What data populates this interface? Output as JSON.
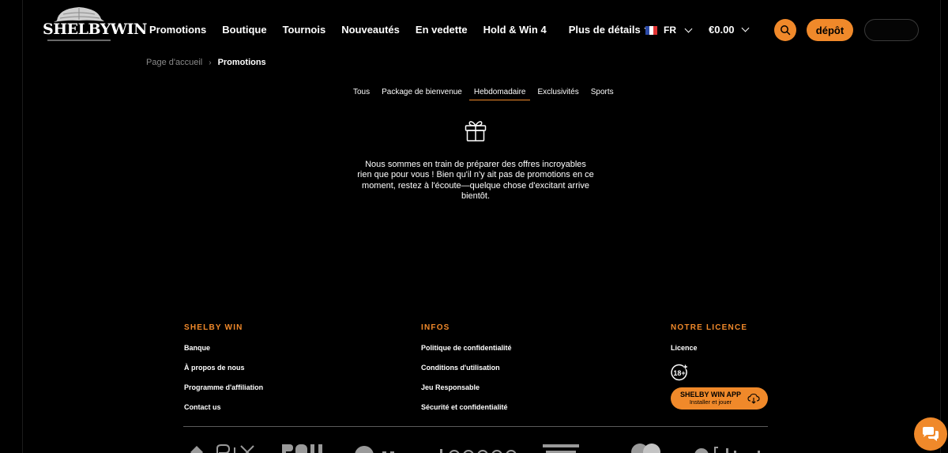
{
  "brand": {
    "logo_text": "SHELBYWIN"
  },
  "nav": {
    "items": [
      "Promotions",
      "Boutique",
      "Tournois",
      "Nouveautés",
      "En vedette",
      "Hold & Win 4"
    ],
    "more_label": "Plus de détails"
  },
  "language": {
    "code": "FR",
    "flag_colors": [
      "#2b4aa8",
      "#ffffff",
      "#e03434"
    ]
  },
  "wallet": {
    "balance": "€0.00"
  },
  "actions": {
    "deposit_label": "dépôt"
  },
  "breadcrumb": {
    "home": "Page d'accueil",
    "separator": "›",
    "current": "Promotions"
  },
  "tabs": {
    "items": [
      "Tous",
      "Package de bienvenue",
      "Hebdomadaire",
      "Exclusivités",
      "Sports"
    ],
    "active": "Hebdomadaire"
  },
  "empty_state": {
    "icon": "gift-icon",
    "message": "Nous sommes en train de préparer des offres incroyables rien que pour vous ! Bien qu'il n'y ait pas de promotions en ce moment, restez à l'écoute—quelque chose d'excitant arrive bientôt."
  },
  "footer": {
    "col1": {
      "heading": "SHELBY WIN",
      "links": [
        "Banque",
        "À propos de nous",
        "Programme d'affiliation",
        "Contact us"
      ]
    },
    "col2": {
      "heading": "INFOS",
      "links": [
        "Politique de confidentialité",
        "Conditions d'utilisation",
        "Jeu Responsable",
        "Sécurité et confidentialité"
      ]
    },
    "col3": {
      "heading": "NOTRE LICENCE",
      "links": [
        "Licence"
      ],
      "age_badge": "18+",
      "app": {
        "title": "SHELBY WIN APP",
        "subtitle": "Installer et jouer"
      }
    }
  },
  "payment_logos": [
    "pix-logo",
    "poli-logo",
    "bank-logo",
    "sirenpay-logo",
    "card-logo",
    "mastercard-logo",
    "bitcoin-logo"
  ],
  "colors": {
    "accent": "#f0892a",
    "background": "#000000"
  }
}
